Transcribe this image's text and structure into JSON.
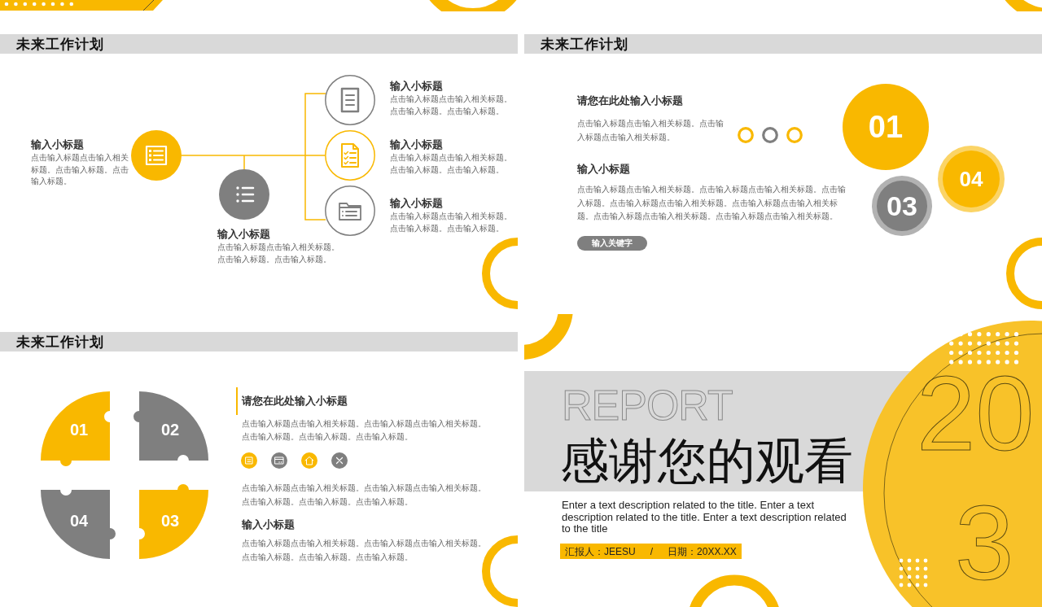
{
  "slides": [
    {
      "kind": "branch_diagram",
      "title": "未来工作计划",
      "nodes": [
        {
          "kind": "filled",
          "color": "#f9b800",
          "heading": "输入小标题",
          "text": "点击输入标题点击输入相关标题。点击输入标题。点击输入标题。"
        },
        {
          "kind": "filled",
          "color": "#7f7f7f",
          "heading": "输入小标题",
          "text": "点击输入标题点击输入相关标题。点击输入标题。点击输入标题。"
        },
        {
          "kind": "ring",
          "color": "#7f7f7f",
          "heading": "输入小标题",
          "text": "点击输入标题点击输入相关标题。点击输入标题。点击输入标题。"
        },
        {
          "kind": "ring",
          "color": "#f9b800",
          "heading": "输入小标题",
          "text": "点击输入标题点击输入相关标题。点击输入标题。点击输入标题。"
        },
        {
          "kind": "ring",
          "color": "#7f7f7f",
          "heading": "输入小标题",
          "text": "点击输入标题点击输入相关标题。点击输入标题。点击输入标题。"
        }
      ]
    },
    {
      "kind": "circle_steps",
      "title": "未来工作计划",
      "heading": "请您在此处输入小标题",
      "text": "点击输入标题点击输入相关标题。点击输入标题点击输入相关标题。",
      "dots": [
        {
          "color": "#f9b800"
        },
        {
          "color": "#7f7f7f"
        },
        {
          "color": "#f9b800"
        }
      ],
      "subheading": "输入小标题",
      "body": "点击输入标题点击输入相关标题。点击输入标题点击输入相关标题。点击输入标题。点击输入标题点击输入相关标题。点击输入标题点击输入相关标题。点击输入标题点击输入相关标题。点击输入标题点击输入相关标题。",
      "keyword": "输入关键字",
      "circles": [
        {
          "label": "01",
          "color": "#f9b800"
        },
        {
          "label": "04",
          "color": "#f9b800"
        },
        {
          "label": "03",
          "color": "#7f7f7f"
        }
      ]
    },
    {
      "kind": "puzzle",
      "title": "未来工作计划",
      "pieces": [
        {
          "label": "01",
          "color": "#f9b800"
        },
        {
          "label": "02",
          "color": "#7f7f7f"
        },
        {
          "label": "04",
          "color": "#7f7f7f"
        },
        {
          "label": "03",
          "color": "#f9b800"
        }
      ],
      "heading": "请您在此处输入小标题",
      "text": "点击输入标题点击输入相关标题。点击输入标题点击输入相关标题。点击输入标题。点击输入标题。点击输入标题。",
      "icons": [
        {
          "color": "#f9b800"
        },
        {
          "color": "#7f7f7f"
        },
        {
          "color": "#f9b800"
        },
        {
          "color": "#7f7f7f"
        }
      ],
      "text_2": "点击输入标题点击输入相关标题。点击输入标题点击输入相关标题。点击输入标题。点击输入标题。点击输入标题。",
      "subheading": "输入小标题",
      "text_3": "点击输入标题点击输入相关标题。点击输入标题点击输入相关标题。点击输入标题。点击输入标题。点击输入标题。"
    },
    {
      "kind": "closing",
      "overline": "REPORT",
      "title": "感谢您的观看",
      "description": "Enter a text description related to the title. Enter a text description related to the title. Enter a text description related to the title",
      "reporter": "汇报人：JEESU",
      "separator": "/",
      "date": "日期：20XX.XX",
      "year_digits": [
        "20",
        "3"
      ]
    }
  ]
}
